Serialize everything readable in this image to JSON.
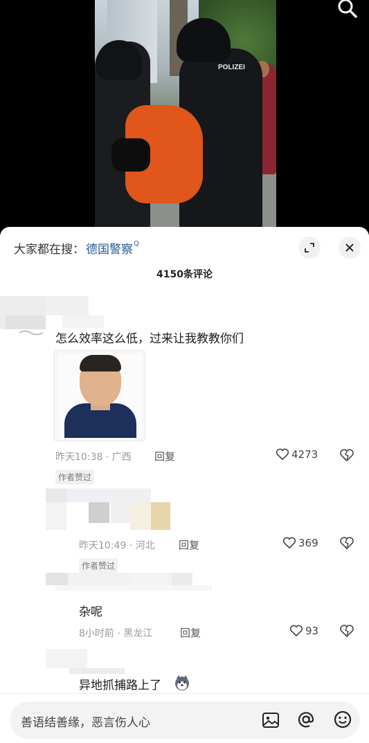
{
  "video": {
    "overlay_text": "POLIZEI"
  },
  "search": {
    "prefix": "大家都在搜：",
    "term": "德国警察",
    "suffix_mark": "Q"
  },
  "comments_header": {
    "count_label": "4150条评论"
  },
  "comments": [
    {
      "text": "怎么效率这么低，过来让我教教你们",
      "time": "昨天10:38 · 广西",
      "reply_label": "回复",
      "likes": "4273",
      "badge": "作者赞过",
      "has_photo": true
    },
    {
      "time": "昨天10:49 · 河北",
      "reply_label": "回复",
      "likes": "369",
      "badge": "作者赞过"
    },
    {
      "text": "杂呢",
      "time": "8小时前 · 黑龙江",
      "reply_label": "回复",
      "likes": "93"
    },
    {
      "text": "异地抓捕路上了"
    }
  ],
  "input": {
    "placeholder": "善语结善缘，恶言伤人心"
  },
  "icons": {
    "search": "search-icon",
    "expand": "expand-icon",
    "close": "close-icon",
    "heart": "heart-icon",
    "dislike": "broken-heart-icon",
    "image": "image-icon",
    "mention": "at-icon",
    "emoji": "emoji-icon"
  },
  "colors": {
    "link": "#2a5a96",
    "meta": "#9a9a9a",
    "input_bg": "#f3f3f3"
  }
}
